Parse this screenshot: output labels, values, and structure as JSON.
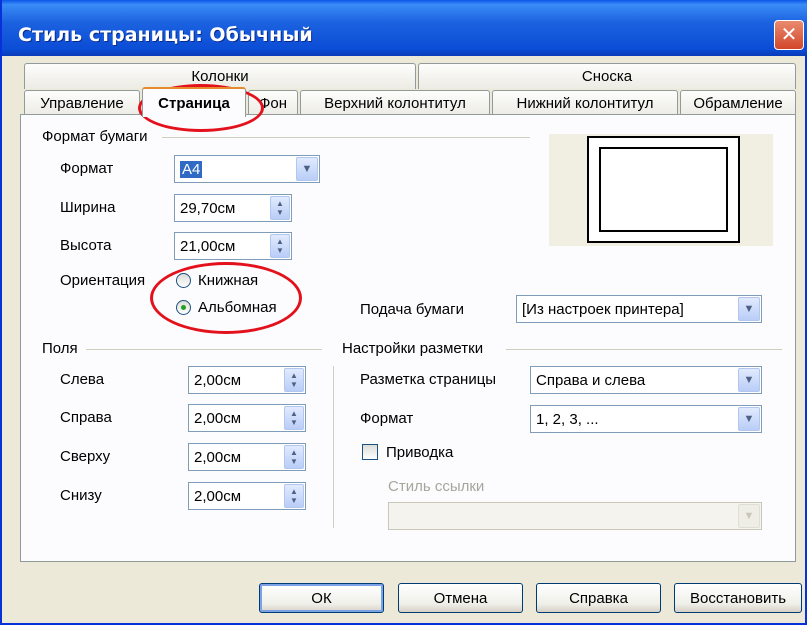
{
  "window": {
    "title": "Стиль страницы: Обычный",
    "close_glyph": "✕"
  },
  "tabs_row1": [
    {
      "label": "Колонки"
    },
    {
      "label": "Сноска"
    }
  ],
  "tabs_row2": [
    {
      "label": "Управление"
    },
    {
      "label": "Страница",
      "active": true
    },
    {
      "label": "Фон"
    },
    {
      "label": "Верхний колонтитул"
    },
    {
      "label": "Нижний колонтитул"
    },
    {
      "label": "Обрамление"
    }
  ],
  "paper": {
    "group_label": "Формат бумаги",
    "format_label": "Формат",
    "format_value": "А4",
    "width_label": "Ширина",
    "width_value": "29,70см",
    "height_label": "Высота",
    "height_value": "21,00см",
    "orientation_label": "Ориентация",
    "portrait_label": "Книжная",
    "landscape_label": "Альбомная",
    "orientation_selected": "landscape",
    "tray_label": "Подача бумаги",
    "tray_value": "[Из настроек принтера]"
  },
  "margins": {
    "group_label": "Поля",
    "left_label": "Слева",
    "left_value": "2,00см",
    "right_label": "Справа",
    "right_value": "2,00см",
    "top_label": "Сверху",
    "top_value": "2,00см",
    "bottom_label": "Снизу",
    "bottom_value": "2,00см"
  },
  "layout": {
    "group_label": "Настройки разметки",
    "page_layout_label": "Разметка страницы",
    "page_layout_value": "Справа и слева",
    "format_label": "Формат",
    "format_value": "1, 2, 3, ...",
    "register_label": "Приводка",
    "register_checked": false,
    "ref_style_label": "Стиль ссылки",
    "ref_style_value": ""
  },
  "buttons": {
    "ok": "ОК",
    "cancel": "Отмена",
    "help": "Справка",
    "reset": "Восстановить"
  },
  "colors": {
    "titlebar": "#0b4dd6",
    "annotation": "#e3111b",
    "selection": "#316ac5"
  }
}
